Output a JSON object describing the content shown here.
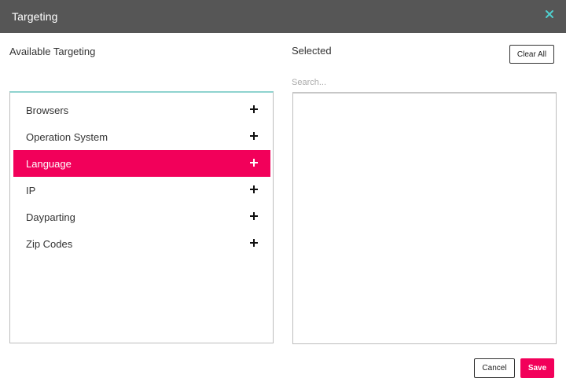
{
  "dialog": {
    "title": "Targeting",
    "close_icon": "close-icon",
    "accent_color": "#f2005a",
    "close_color": "#4fd0cf"
  },
  "available": {
    "label": "Available Targeting",
    "items": [
      {
        "label": "Browsers",
        "active": false
      },
      {
        "label": "Operation System",
        "active": false
      },
      {
        "label": "Language",
        "active": true
      },
      {
        "label": "IP",
        "active": false
      },
      {
        "label": "Dayparting",
        "active": false
      },
      {
        "label": "Zip Codes",
        "active": false
      }
    ]
  },
  "selected": {
    "label": "Selected",
    "clear_all_label": "Clear All",
    "search_placeholder": "Search..."
  },
  "footer": {
    "cancel_label": "Cancel",
    "save_label": "Save"
  }
}
